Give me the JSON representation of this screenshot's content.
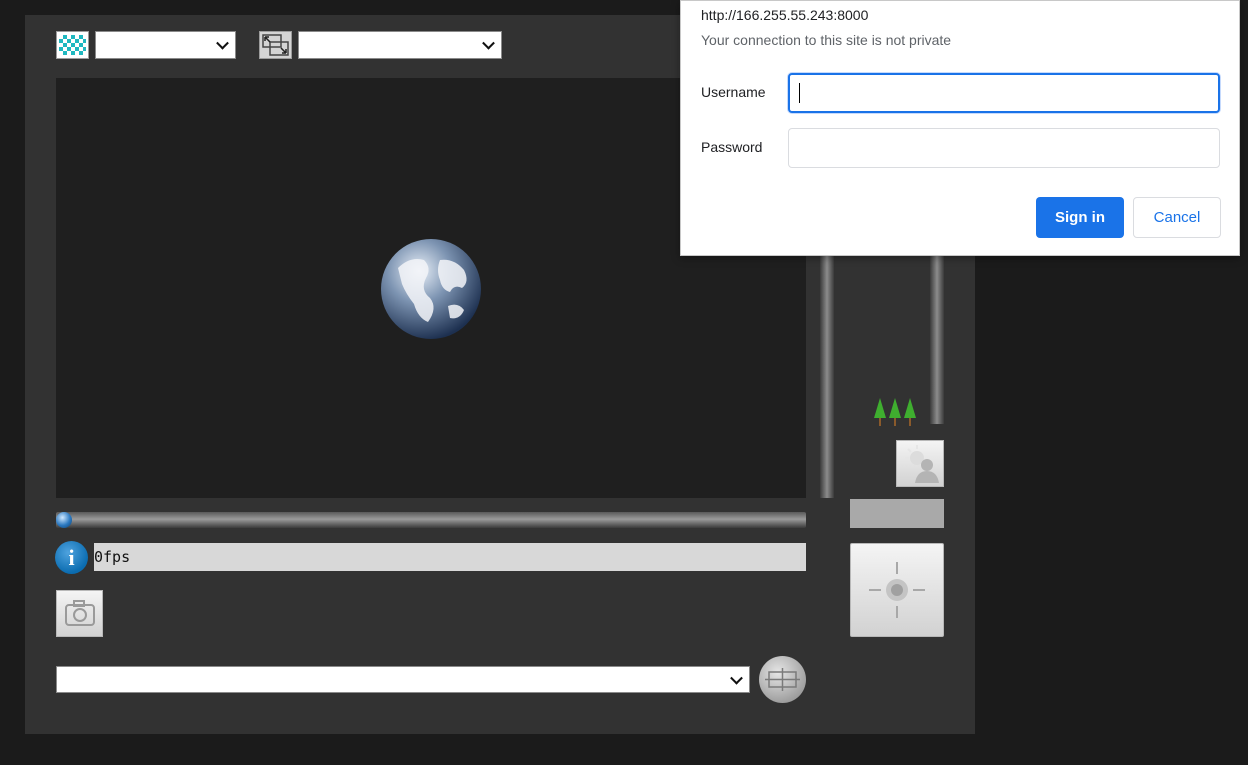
{
  "toolbar": {
    "stream_select": {
      "value": ""
    },
    "size_select": {
      "value": ""
    }
  },
  "viewer": {
    "status_text": "0fps"
  },
  "bottom": {
    "preset_select": {
      "value": ""
    }
  },
  "icons": {
    "stream": "checker-grid-icon",
    "size": "resize-arrows-icon",
    "loading": "globe-icon",
    "info": "info-icon",
    "snapshot": "camera-icon",
    "fullscreen": "crosshair-frame-icon",
    "focus_far": "trees-icon",
    "backlight": "backlight-person-icon",
    "ptz_home": "ptz-home-icon"
  },
  "auth_dialog": {
    "url": "http://166.255.55.243:8000",
    "warning": "Your connection to this site is not private",
    "username_label": "Username",
    "password_label": "Password",
    "username_value": "",
    "password_value": "",
    "sign_in_label": "Sign in",
    "cancel_label": "Cancel"
  },
  "colors": {
    "accent": "#1a73e8",
    "panel": "#323232",
    "background": "#1b1b1b"
  }
}
